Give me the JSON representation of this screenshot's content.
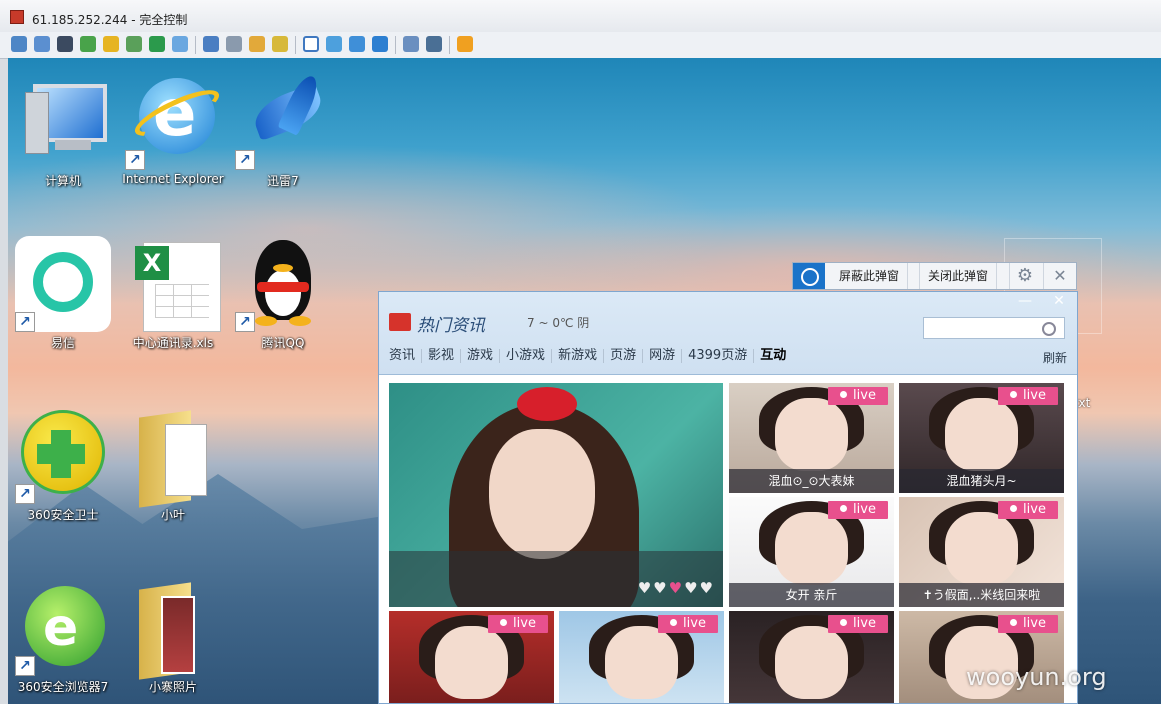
{
  "window": {
    "title": "61.185.252.244 - 完全控制"
  },
  "desktop_icons": [
    {
      "label": "计算机",
      "icon": "computer-icon",
      "shortcut": false
    },
    {
      "label": "Internet Explorer",
      "icon": "ie-icon",
      "shortcut": true
    },
    {
      "label": "迅雷7",
      "icon": "thunder-bird-icon",
      "shortcut": true
    },
    {
      "label": "易信",
      "icon": "yixin-icon",
      "shortcut": true
    },
    {
      "label": "中心通讯录.xls",
      "icon": "excel-icon",
      "shortcut": false
    },
    {
      "label": "腾讯QQ",
      "icon": "qq-penguin-icon",
      "shortcut": true
    },
    {
      "label": "360安全卫士",
      "icon": "360-safe-icon",
      "shortcut": true
    },
    {
      "label": "小叶",
      "icon": "folder-icon",
      "shortcut": false
    },
    {
      "label": "360安全浏览器7",
      "icon": "360-browser-icon",
      "shortcut": true
    },
    {
      "label": "小寨照片",
      "icon": "folder-photo-icon",
      "shortcut": false
    }
  ],
  "partial_icon_label": ".txt",
  "popup_bar": {
    "block_label": "屏蔽此弹窗",
    "close_label": "关闭此弹窗"
  },
  "news": {
    "title": "热门资讯",
    "weather": "7 ~ 0℃ 阴",
    "search_placeholder": "",
    "tabs": [
      "资讯",
      "影视",
      "游戏",
      "小游戏",
      "新游戏",
      "页游",
      "网游",
      "4399页游",
      "互动"
    ],
    "active_tab": "互动",
    "refresh_label": "刷新",
    "live_badge": "live",
    "hearts": "♥♥♥♥♥",
    "tiles": [
      {
        "caption": "混血⊙_⊙大表妹",
        "live": true
      },
      {
        "caption": "混血猪头月~",
        "live": true
      },
      {
        "caption": "女开 亲斤",
        "live": true
      },
      {
        "caption": "✝う假面,..米线回来啦",
        "live": true
      },
      {
        "caption": "",
        "live": true
      },
      {
        "caption": "",
        "live": true
      },
      {
        "caption": "",
        "live": true
      },
      {
        "caption": "",
        "live": true
      }
    ]
  },
  "watermark": "wooyun.org",
  "colors": {
    "accent": "#1a73c9",
    "live_badge": "#e8508d",
    "panel_head": "#dbe9f6"
  }
}
